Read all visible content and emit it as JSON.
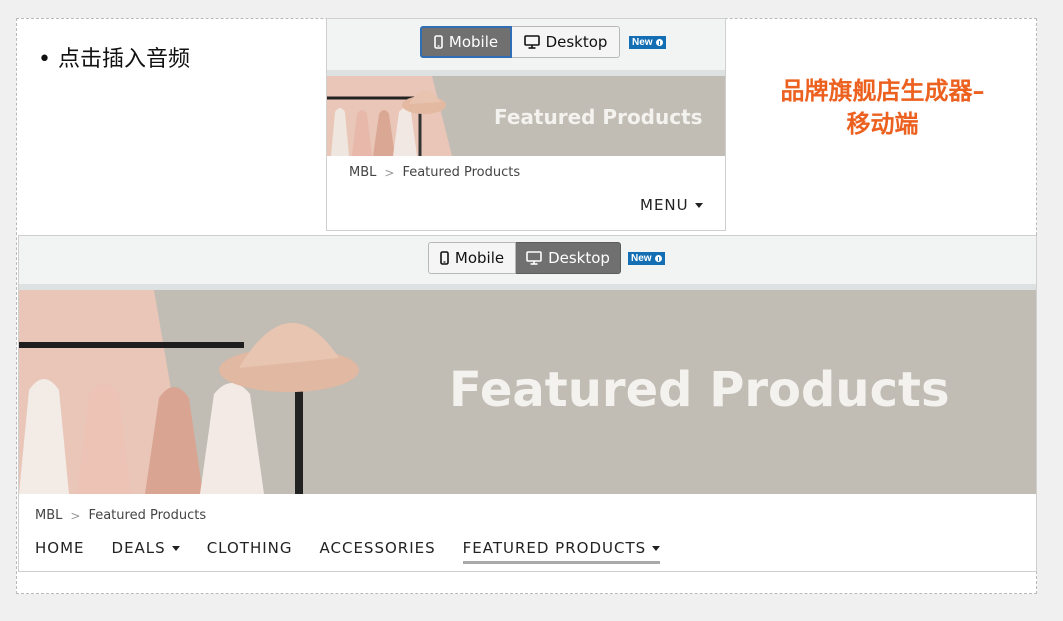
{
  "bullet_text": "• 点击插入音频",
  "title": "品牌旗舰店生成器–移动端",
  "toggle": {
    "mobile_label": "Mobile",
    "desktop_label": "Desktop",
    "new_badge": "New"
  },
  "banner_text": "Featured Products",
  "breadcrumb": {
    "root": "MBL",
    "current": "Featured Products"
  },
  "mobile_preview": {
    "selected": "Mobile",
    "menu_label": "MENU"
  },
  "desktop_preview": {
    "selected": "Desktop",
    "nav_items": [
      {
        "label": "HOME",
        "dropdown": false
      },
      {
        "label": "DEALS",
        "dropdown": true
      },
      {
        "label": "CLOTHING",
        "dropdown": false
      },
      {
        "label": "ACCESSORIES",
        "dropdown": false
      },
      {
        "label": "FEATURED PRODUCTS",
        "dropdown": true,
        "active": true
      }
    ]
  },
  "colors": {
    "title": "#ec6120",
    "badge": "#146eb4",
    "active_toggle": "#707070",
    "banner_bg": "#c1bcb4"
  }
}
